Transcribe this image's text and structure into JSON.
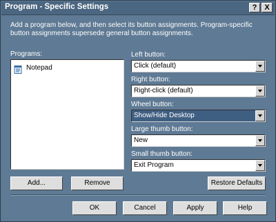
{
  "window": {
    "title": "Program - Specific Settings",
    "help_button": "?",
    "close_button": "X"
  },
  "description": "Add a program below, and then select its button assignments. Program-specific button assignments supersede general button assignments.",
  "programs": {
    "label": "Programs:",
    "items": [
      {
        "label": "Notepad",
        "icon": "notepad-icon"
      }
    ]
  },
  "assignments": [
    {
      "label": "Left button:",
      "value": "Click (default)",
      "selected": false
    },
    {
      "label": "Right button:",
      "value": "Right-click (default)",
      "selected": false
    },
    {
      "label": "Wheel button:",
      "value": "Show/Hide Desktop",
      "selected": true
    },
    {
      "label": "Large thumb button:",
      "value": "New",
      "selected": false
    },
    {
      "label": "Small thumb button:",
      "value": "Exit Program",
      "selected": false
    }
  ],
  "buttons": {
    "add": "Add...",
    "remove": "Remove",
    "restore": "Restore Defaults",
    "ok": "OK",
    "cancel": "Cancel",
    "apply": "Apply",
    "help": "Help"
  },
  "colors": {
    "dialog_bg": "#5f7a94",
    "titlebar_bg": "#4b6680",
    "selection_bg": "#3f5f82"
  }
}
